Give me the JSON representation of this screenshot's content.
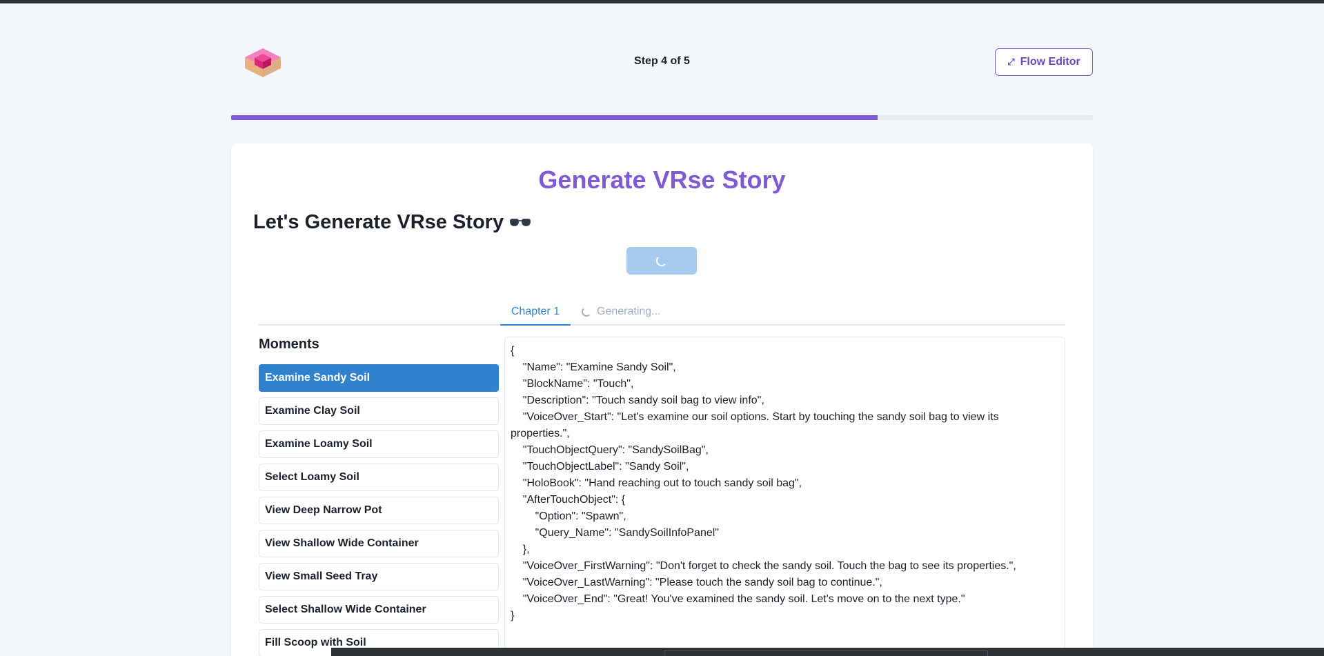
{
  "header": {
    "step_label": "Step 4 of 5",
    "flow_editor_label": "Flow Editor",
    "flow_editor_icon": "flow-arrow-icon"
  },
  "progress": {
    "fraction": 0.75,
    "color": "#805ad5"
  },
  "page": {
    "title": "Generate VRse Story",
    "subtitle": "Let's Generate VRse Story",
    "subtitle_icon": "sunglasses-icon",
    "generate_button_state": "loading"
  },
  "tabs": [
    {
      "label": "Chapter 1",
      "active": true
    },
    {
      "label": "Generating...",
      "loading": true
    }
  ],
  "moments": {
    "title": "Moments",
    "items": [
      "Examine Sandy Soil",
      "Examine Clay Soil",
      "Examine Loamy Soil",
      "Select Loamy Soil",
      "View Deep Narrow Pot",
      "View Shallow Wide Container",
      "View Small Seed Tray",
      "Select Shallow Wide Container",
      "Fill Scoop with Soil"
    ],
    "selected_index": 0
  },
  "editor": {
    "content": "{\n    \"Name\": \"Examine Sandy Soil\",\n    \"BlockName\": \"Touch\",\n    \"Description\": \"Touch sandy soil bag to view info\",\n    \"VoiceOver_Start\": \"Let's examine our soil options. Start by touching the sandy soil bag to view its properties.\",\n    \"TouchObjectQuery\": \"SandySoilBag\",\n    \"TouchObjectLabel\": \"Sandy Soil\",\n    \"HoloBook\": \"Hand reaching out to touch sandy soil bag\",\n    \"AfterTouchObject\": {\n        \"Option\": \"Spawn\",\n        \"Query_Name\": \"SandySoilInfoPanel\"\n    },\n    \"VoiceOver_FirstWarning\": \"Don't forget to check the sandy soil. Touch the bag to see its properties.\",\n    \"VoiceOver_LastWarning\": \"Please touch the sandy soil bag to continue.\",\n    \"VoiceOver_End\": \"Great! You've examined the sandy soil. Let's move on to the next type.\"\n}"
  },
  "colors": {
    "accent": "#805ad5",
    "primary": "#3182ce",
    "button_loading": "#a7cbee"
  }
}
